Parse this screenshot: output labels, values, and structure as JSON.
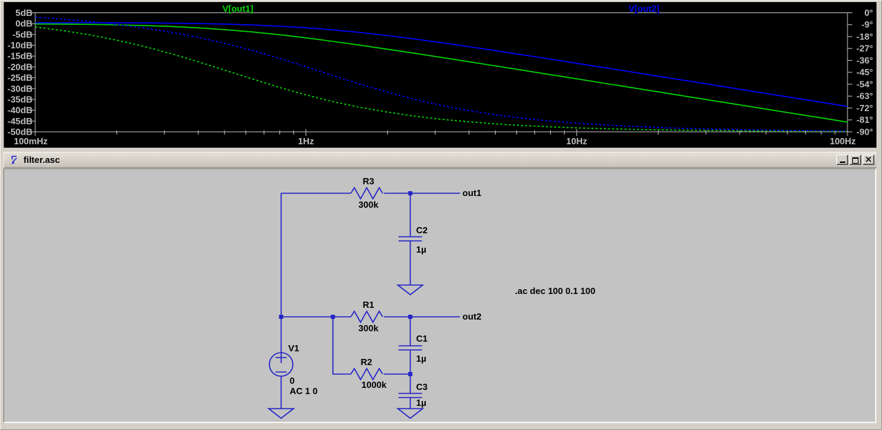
{
  "window": {
    "title": "filter.asc"
  },
  "titlebar": {
    "icons": {
      "app": "ltspice-schematic-icon",
      "minimize": "minimize-icon",
      "maximize": "maximize-icon",
      "close": "close-icon"
    }
  },
  "chart_data": {
    "type": "line",
    "title": "",
    "background": "#000000",
    "axis_color": "#bebebe",
    "grid": false,
    "legend_position": "top",
    "legend": [
      {
        "label": "V[out1]",
        "color": "#00d800"
      },
      {
        "label": "V[out2]",
        "color": "#0000ff"
      }
    ],
    "x_axis": {
      "scale": "log",
      "unit": "Hz",
      "range": [
        0.1,
        100
      ],
      "ticks": [
        {
          "f": 0.1,
          "label": "100mHz"
        },
        {
          "f": 1,
          "label": "1Hz"
        },
        {
          "f": 10,
          "label": "10Hz"
        },
        {
          "f": 100,
          "label": "100Hz"
        }
      ]
    },
    "y_axis_left": {
      "unit": "dB",
      "range": [
        -50,
        5
      ],
      "step": 5,
      "ticks": [
        "5dB",
        "0dB",
        "-5dB",
        "-10dB",
        "-15dB",
        "-20dB",
        "-25dB",
        "-30dB",
        "-35dB",
        "-40dB",
        "-45dB",
        "-50dB"
      ]
    },
    "y_axis_right": {
      "unit": "degrees",
      "range": [
        -90,
        0
      ],
      "step": 9,
      "ticks": [
        "0°",
        "-9°",
        "-18°",
        "-27°",
        "-36°",
        "-45°",
        "-54°",
        "-63°",
        "-72°",
        "-81°",
        "-90°"
      ]
    },
    "series": [
      {
        "name": "V[out1] magnitude",
        "color": "#00d800",
        "axis": "left",
        "line": "solid",
        "points": [
          [
            0.1,
            -0.15
          ],
          [
            0.126,
            -0.24
          ],
          [
            0.158,
            -0.37
          ],
          [
            0.2,
            -0.58
          ],
          [
            0.251,
            -0.88
          ],
          [
            0.316,
            -1.32
          ],
          [
            0.398,
            -1.94
          ],
          [
            0.501,
            -2.77
          ],
          [
            0.631,
            -3.83
          ],
          [
            0.794,
            -5.11
          ],
          [
            1,
            -6.58
          ],
          [
            1.26,
            -8.22
          ],
          [
            1.58,
            -9.94
          ],
          [
            2,
            -11.82
          ],
          [
            2.51,
            -13.69
          ],
          [
            3.16,
            -15.62
          ],
          [
            3.98,
            -17.58
          ],
          [
            5.01,
            -19.55
          ],
          [
            6.31,
            -21.54
          ],
          [
            7.94,
            -23.52
          ],
          [
            10,
            -25.52
          ],
          [
            12.6,
            -27.52
          ],
          [
            15.8,
            -29.49
          ],
          [
            20,
            -31.53
          ],
          [
            25.1,
            -33.5
          ],
          [
            31.6,
            -35.51
          ],
          [
            39.8,
            -37.51
          ],
          [
            50.1,
            -39.5
          ],
          [
            63.1,
            -41.51
          ],
          [
            79.4,
            -43.5
          ],
          [
            100,
            -45.51
          ]
        ]
      },
      {
        "name": "V[out1] phase",
        "color": "#00d800",
        "axis": "right",
        "line": "dotted",
        "points": [
          [
            0.1,
            -10.7
          ],
          [
            0.126,
            -13.4
          ],
          [
            0.158,
            -16.6
          ],
          [
            0.2,
            -20.7
          ],
          [
            0.251,
            -25.3
          ],
          [
            0.316,
            -30.8
          ],
          [
            0.398,
            -36.9
          ],
          [
            0.501,
            -43.4
          ],
          [
            0.631,
            -49.9
          ],
          [
            0.794,
            -56.3
          ],
          [
            1,
            -62.1
          ],
          [
            1.26,
            -67.2
          ],
          [
            1.58,
            -71.4
          ],
          [
            2,
            -75.1
          ],
          [
            2.51,
            -78.1
          ],
          [
            3.16,
            -80.5
          ],
          [
            3.98,
            -82.4
          ],
          [
            5.01,
            -84
          ],
          [
            6.31,
            -85.2
          ],
          [
            7.94,
            -86.2
          ],
          [
            10,
            -87
          ],
          [
            12.6,
            -87.6
          ],
          [
            15.8,
            -88.1
          ],
          [
            20,
            -88.5
          ],
          [
            25.1,
            -88.8
          ],
          [
            31.6,
            -89
          ],
          [
            39.8,
            -89.2
          ],
          [
            50.1,
            -89.4
          ],
          [
            63.1,
            -89.5
          ],
          [
            79.4,
            -89.6
          ],
          [
            100,
            -89.7
          ]
        ]
      },
      {
        "name": "V[out2] magnitude",
        "color": "#0000ff",
        "axis": "left",
        "line": "solid",
        "points": [
          [
            0.1,
            0.33
          ],
          [
            0.126,
            0.36
          ],
          [
            0.158,
            0.37
          ],
          [
            0.2,
            0.35
          ],
          [
            0.251,
            0.3
          ],
          [
            0.316,
            0.2
          ],
          [
            0.398,
            0.03
          ],
          [
            0.501,
            -0.23
          ],
          [
            0.631,
            -0.62
          ],
          [
            0.794,
            -1.17
          ],
          [
            1,
            -1.92
          ],
          [
            1.26,
            -2.9
          ],
          [
            1.58,
            -4.09
          ],
          [
            2,
            -5.53
          ],
          [
            2.51,
            -7.09
          ],
          [
            3.16,
            -8.8
          ],
          [
            3.98,
            -10.62
          ],
          [
            5.01,
            -12.49
          ],
          [
            6.31,
            -14.41
          ],
          [
            7.94,
            -16.36
          ],
          [
            10,
            -18.33
          ],
          [
            12.6,
            -20.31
          ],
          [
            15.8,
            -22.27
          ],
          [
            20,
            -24.31
          ],
          [
            25.1,
            -26.27
          ],
          [
            31.6,
            -28.27
          ],
          [
            39.8,
            -30.27
          ],
          [
            50.1,
            -32.27
          ],
          [
            63.1,
            -34.27
          ],
          [
            79.4,
            -36.27
          ],
          [
            100,
            -38.27
          ]
        ]
      },
      {
        "name": "V[out2] phase",
        "color": "#0000ff",
        "axis": "right",
        "line": "dotted",
        "points": [
          [
            0.1,
            -3.3
          ],
          [
            0.126,
            -4.8
          ],
          [
            0.158,
            -6.5
          ],
          [
            0.2,
            -8.8
          ],
          [
            0.251,
            -11.4
          ],
          [
            0.316,
            -14.6
          ],
          [
            0.398,
            -18.5
          ],
          [
            0.501,
            -23.1
          ],
          [
            0.631,
            -28.4
          ],
          [
            0.794,
            -34.4
          ],
          [
            1,
            -40.8
          ],
          [
            1.26,
            -47.5
          ],
          [
            1.58,
            -53.9
          ],
          [
            2,
            -60
          ],
          [
            2.51,
            -65.4
          ],
          [
            3.16,
            -70
          ],
          [
            3.98,
            -73.9
          ],
          [
            5.01,
            -77.1
          ],
          [
            6.31,
            -79.7
          ],
          [
            7.94,
            -81.8
          ],
          [
            10,
            -83.4
          ],
          [
            12.6,
            -84.8
          ],
          [
            15.8,
            -85.8
          ],
          [
            20,
            -86.7
          ],
          [
            25.1,
            -87.4
          ],
          [
            31.6,
            -87.9
          ],
          [
            39.8,
            -88.3
          ],
          [
            50.1,
            -88.7
          ],
          [
            63.1,
            -89
          ],
          [
            79.4,
            -89.2
          ],
          [
            100,
            -89.3
          ]
        ]
      }
    ]
  },
  "schematic": {
    "directive": ".ac dec 100 0.1 100",
    "wire_color": "#2424c8",
    "components": [
      {
        "ref": "R3",
        "value": "300k"
      },
      {
        "ref": "C2",
        "value": "1µ"
      },
      {
        "ref": "R1",
        "value": "300k"
      },
      {
        "ref": "C1",
        "value": "1µ"
      },
      {
        "ref": "R2",
        "value": "1000k"
      },
      {
        "ref": "C3",
        "value": "1µ"
      },
      {
        "ref": "V1",
        "value": "0",
        "value2": "AC 1 0"
      }
    ],
    "nets": {
      "out1": "out1",
      "out2": "out2"
    }
  }
}
